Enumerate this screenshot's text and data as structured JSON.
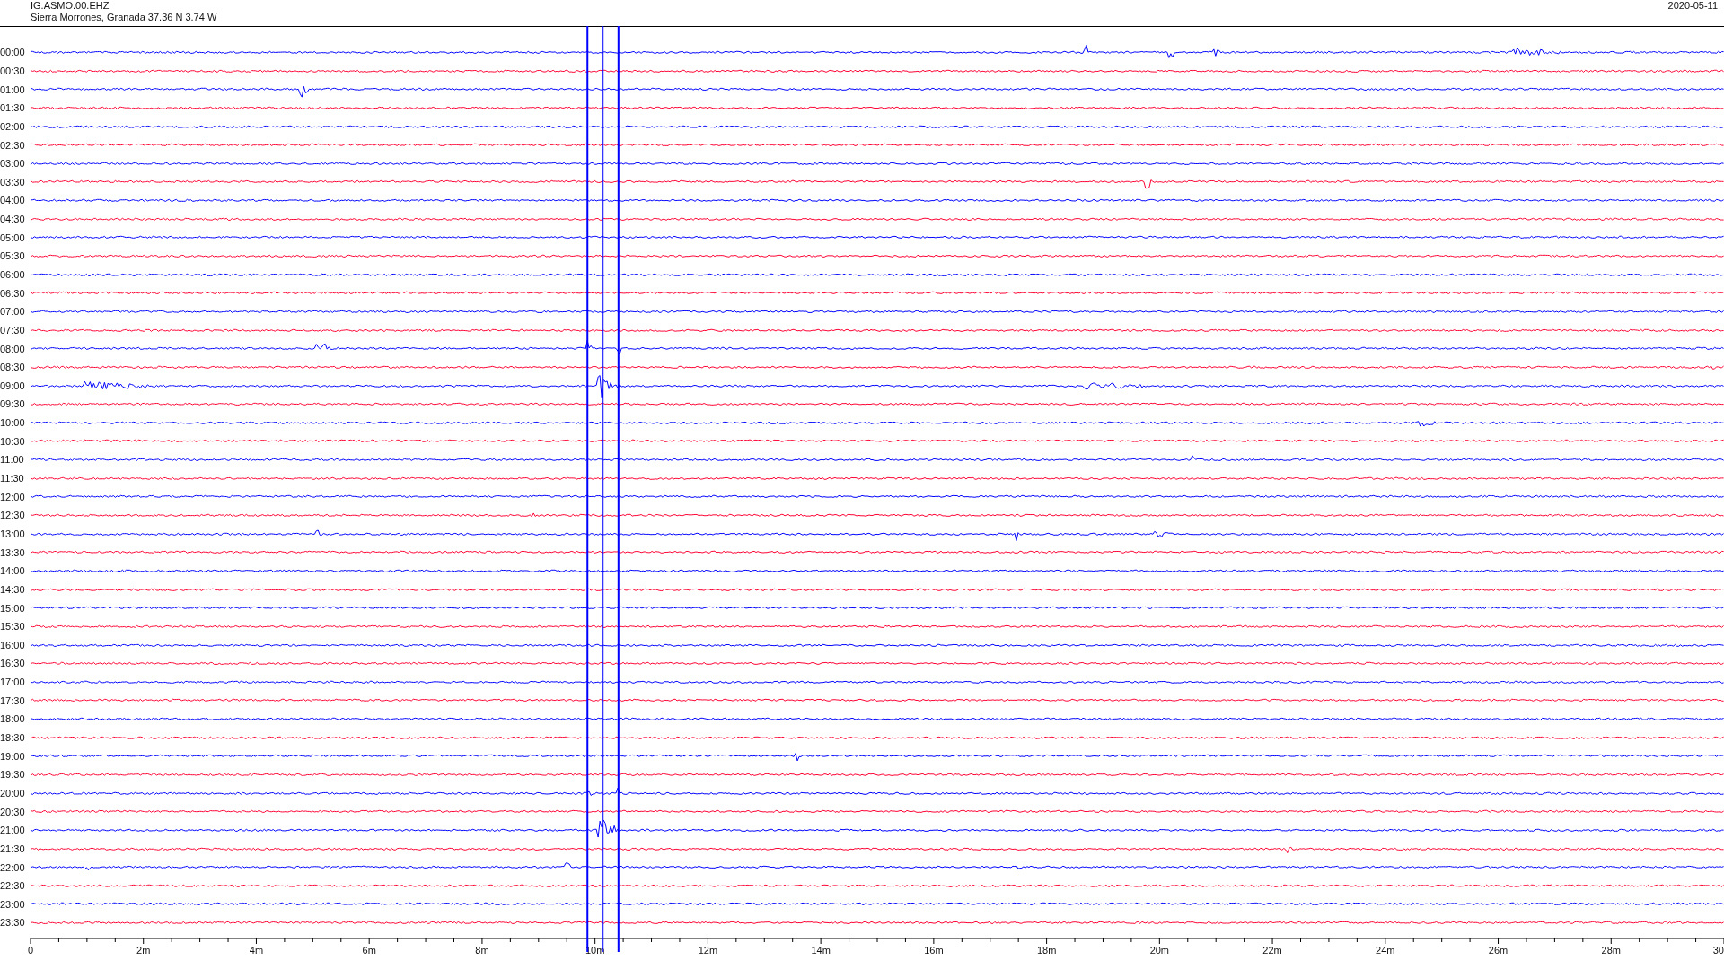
{
  "header": {
    "channel": "IG.ASMO.00.EHZ",
    "location": "Sierra Morrones, Granada  37.36 N 3.74 W",
    "date": "2020-05-11"
  },
  "traces": [
    {
      "time": "00:00",
      "color": "#0000ff"
    },
    {
      "time": "00:30",
      "color": "#ff0033"
    },
    {
      "time": "01:00",
      "color": "#0000ff"
    },
    {
      "time": "01:30",
      "color": "#ff0033"
    },
    {
      "time": "02:00",
      "color": "#0000ff"
    },
    {
      "time": "02:30",
      "color": "#ff0033"
    },
    {
      "time": "03:00",
      "color": "#0000ff"
    },
    {
      "time": "03:30",
      "color": "#ff0033"
    },
    {
      "time": "04:00",
      "color": "#0000ff"
    },
    {
      "time": "04:30",
      "color": "#ff0033"
    },
    {
      "time": "05:00",
      "color": "#0000ff"
    },
    {
      "time": "05:30",
      "color": "#ff0033"
    },
    {
      "time": "06:00",
      "color": "#0000ff"
    },
    {
      "time": "06:30",
      "color": "#ff0033"
    },
    {
      "time": "07:00",
      "color": "#0000ff"
    },
    {
      "time": "07:30",
      "color": "#ff0033"
    },
    {
      "time": "08:00",
      "color": "#0000ff"
    },
    {
      "time": "08:30",
      "color": "#ff0033"
    },
    {
      "time": "09:00",
      "color": "#0000ff"
    },
    {
      "time": "09:30",
      "color": "#ff0033"
    },
    {
      "time": "10:00",
      "color": "#0000ff"
    },
    {
      "time": "10:30",
      "color": "#ff0033"
    },
    {
      "time": "11:00",
      "color": "#0000ff"
    },
    {
      "time": "11:30",
      "color": "#ff0033"
    },
    {
      "time": "12:00",
      "color": "#0000ff"
    },
    {
      "time": "12:30",
      "color": "#ff0033"
    },
    {
      "time": "13:00",
      "color": "#0000ff"
    },
    {
      "time": "13:30",
      "color": "#ff0033"
    },
    {
      "time": "14:00",
      "color": "#0000ff"
    },
    {
      "time": "14:30",
      "color": "#ff0033"
    },
    {
      "time": "15:00",
      "color": "#0000ff"
    },
    {
      "time": "15:30",
      "color": "#ff0033"
    },
    {
      "time": "16:00",
      "color": "#0000ff"
    },
    {
      "time": "16:30",
      "color": "#ff0033"
    },
    {
      "time": "17:00",
      "color": "#0000ff"
    },
    {
      "time": "17:30",
      "color": "#ff0033"
    },
    {
      "time": "18:00",
      "color": "#0000ff"
    },
    {
      "time": "18:30",
      "color": "#ff0033"
    },
    {
      "time": "19:00",
      "color": "#0000ff"
    },
    {
      "time": "19:30",
      "color": "#ff0033"
    },
    {
      "time": "20:00",
      "color": "#0000ff"
    },
    {
      "time": "20:30",
      "color": "#ff0033"
    },
    {
      "time": "21:00",
      "color": "#0000ff"
    },
    {
      "time": "21:30",
      "color": "#ff0033"
    },
    {
      "time": "22:00",
      "color": "#0000ff"
    },
    {
      "time": "22:30",
      "color": "#ff0033"
    },
    {
      "time": "23:00",
      "color": "#0000ff"
    },
    {
      "time": "23:30",
      "color": "#ff0033"
    }
  ],
  "axis": {
    "ticks": [
      "0",
      "2m",
      "4m",
      "6m",
      "8m",
      "10m",
      "12m",
      "14m",
      "16m",
      "18m",
      "20m",
      "22m",
      "24m",
      "26m",
      "28m",
      "30"
    ]
  }
}
